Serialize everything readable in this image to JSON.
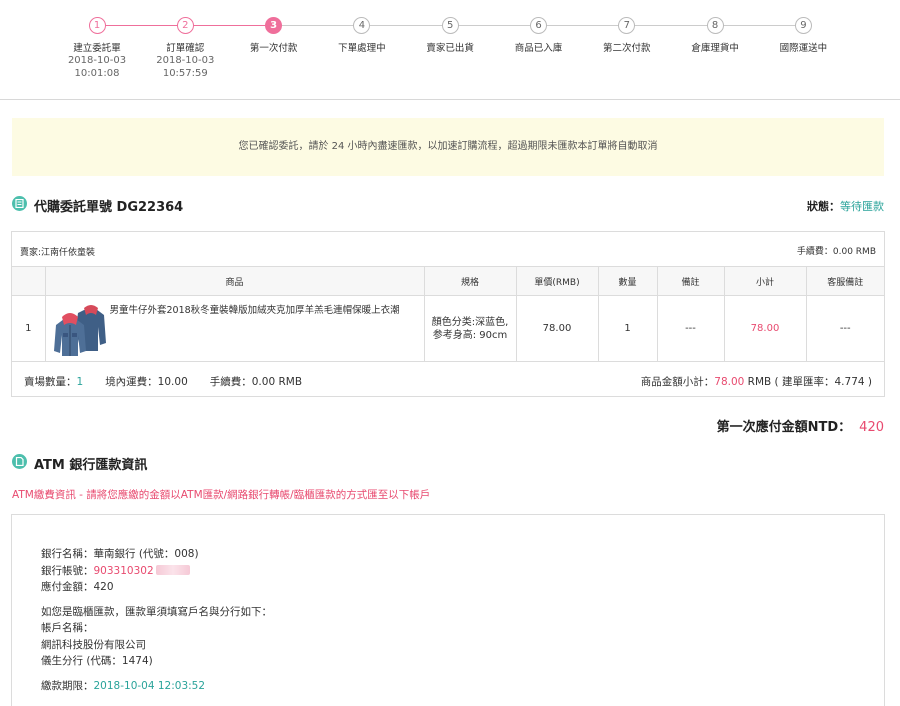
{
  "steps": [
    {
      "num": "1",
      "label": "建立委託單",
      "date": "2018-10-03",
      "time": "10:01:08",
      "state": "done"
    },
    {
      "num": "2",
      "label": "訂單確認",
      "date": "2018-10-03",
      "time": "10:57:59",
      "state": "done"
    },
    {
      "num": "3",
      "label": "第一次付款",
      "date": "",
      "time": "",
      "state": "current"
    },
    {
      "num": "4",
      "label": "下單處理中",
      "date": "",
      "time": "",
      "state": "todo"
    },
    {
      "num": "5",
      "label": "賣家已出貨",
      "date": "",
      "time": "",
      "state": "todo"
    },
    {
      "num": "6",
      "label": "商品已入庫",
      "date": "",
      "time": "",
      "state": "todo"
    },
    {
      "num": "7",
      "label": "第二次付款",
      "date": "",
      "time": "",
      "state": "todo"
    },
    {
      "num": "8",
      "label": "倉庫理貨中",
      "date": "",
      "time": "",
      "state": "todo"
    },
    {
      "num": "9",
      "label": "國際運送中",
      "date": "",
      "time": "",
      "state": "todo"
    }
  ],
  "notice": "您已確認委託，請於 24 小時內盡速匯款，以加速訂購流程，超過期限未匯款本訂單將自動取消",
  "order": {
    "title": "代購委託單號 DG22364",
    "status_label": "狀態：",
    "status_value": "等待匯款",
    "vendor": "賣家:江南仟依童裝",
    "fee_top": "手續費：0.00 RMB",
    "headers": [
      "",
      "商品",
      "規格",
      "單價(RMB)",
      "數量",
      "備註",
      "小計",
      "客服備註"
    ],
    "row": {
      "index": "1",
      "product": "男童牛仔外套2018秋冬童裝韓版加絨夾克加厚羊羔毛連帽保暖上衣潮",
      "spec_line1": "顏色分类:深蓝色,",
      "spec_line2": "参考身高: 90cm",
      "price": "78.00",
      "qty": "1",
      "note": "---",
      "subtotal": "78.00",
      "cs_note": "---"
    },
    "foot": {
      "qty_label": "賣場數量：",
      "qty_value": "1",
      "domestic": "境內運費：10.00",
      "fee": "手續費：0.00 RMB",
      "subtotal_label": "商品金額小計：",
      "subtotal_value": "78.00",
      "subtotal_suffix": " RMB ( 建單匯率：4.774 )"
    }
  },
  "first_payment": {
    "label": "第一次應付金額NTD：",
    "amount": "420"
  },
  "atm": {
    "title": "ATM 銀行匯款資訊",
    "note": "ATM繳費資訊 - 請將您應繳的金額以ATM匯款/網路銀行轉帳/臨櫃匯款的方式匯至以下帳戶",
    "bank_name": "銀行名稱：華南銀行 (代號：008)",
    "account_label": "銀行帳號：",
    "account_value": "903310302",
    "amount_due": "應付金額：420",
    "counter_note": "如您是臨櫃匯款，匯款單須填寫戶名與分行如下：",
    "holder_label": "帳戶名稱：",
    "holder_value": "網訊科技股份有限公司",
    "branch": "儀生分行 (代碼：1474)",
    "deadline_label": "繳款期限：",
    "deadline_value": "2018-10-04 12:03:52"
  },
  "colors": {
    "accent_pink": "#ef6f9b",
    "price_pink": "#e84a6f",
    "teal": "#2aa39a"
  }
}
